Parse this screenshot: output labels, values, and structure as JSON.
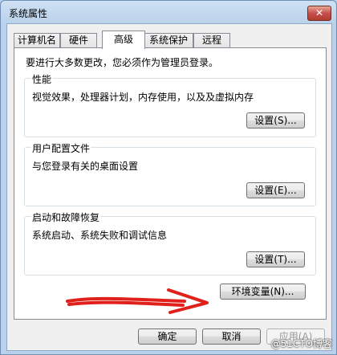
{
  "window": {
    "title": "系统属性",
    "close_glyph": "✕"
  },
  "tabs": [
    {
      "label": "计算机名",
      "active": false
    },
    {
      "label": "硬件",
      "active": false
    },
    {
      "label": "高级",
      "active": true
    },
    {
      "label": "系统保护",
      "active": false
    },
    {
      "label": "远程",
      "active": false
    }
  ],
  "panel": {
    "note": "要进行大多数更改，您必须作为管理员登录。",
    "groups": [
      {
        "title": "性能",
        "description": "视觉效果，处理器计划，内存使用，以及及虚拟内存",
        "button": "设置(S)..."
      },
      {
        "title": "用户配置文件",
        "description": "与您登录有关的桌面设置",
        "button": "设置(E)..."
      },
      {
        "title": "启动和故障恢复",
        "description": "系统启动、系统失败和调试信息",
        "button": "设置(T)..."
      }
    ],
    "env_button": "环境变量(N)..."
  },
  "footer": {
    "ok": "确定",
    "cancel": "取消",
    "apply": "应用(A)"
  },
  "annotation": {
    "arrow_color": "#e0211b"
  },
  "watermark": "@51CTO博客"
}
